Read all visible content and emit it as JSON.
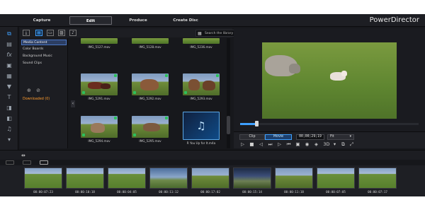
{
  "app": {
    "brand": "PowerDirector",
    "modes": [
      "Capture",
      "Edit",
      "Produce",
      "Create Disc"
    ],
    "active_mode": "Edit"
  },
  "tools": [
    {
      "icon": "media-room-icon"
    },
    {
      "icon": "title-room-icon"
    },
    {
      "icon": "fx-room-icon",
      "glyph": "fx"
    },
    {
      "icon": "pip-room-icon"
    },
    {
      "icon": "particle-room-icon"
    },
    {
      "icon": "text-room-icon",
      "glyph": "T"
    },
    {
      "icon": "transition-room-icon"
    },
    {
      "icon": "subtitle-room-icon"
    },
    {
      "icon": "audio-room-icon"
    },
    {
      "icon": "more-rooms-icon"
    }
  ],
  "library": {
    "search_placeholder": "Search the library",
    "categories": [
      "Media Content",
      "Color Boards",
      "Background Music",
      "Sound Clips"
    ],
    "active_category": "Media Content",
    "downloaded_label": "Downloaded",
    "downloaded_count": "(0)",
    "items": [
      {
        "label": "IMG_5127.mov",
        "type": "video",
        "partial": true
      },
      {
        "label": "IMG_5128.mov",
        "type": "video",
        "partial": true
      },
      {
        "label": "IMG_5236.mov",
        "type": "video",
        "partial": true
      },
      {
        "label": "IMG_5291.mov",
        "type": "video"
      },
      {
        "label": "IMG_5292.mov",
        "type": "video"
      },
      {
        "label": "IMG_5293.mov",
        "type": "video"
      },
      {
        "label": "IMG_5294.mov",
        "type": "video"
      },
      {
        "label": "IMG_5295.mov",
        "type": "video"
      },
      {
        "label": "R You Up for It.m4a",
        "type": "audio"
      }
    ]
  },
  "preview": {
    "clip_label": "Clip",
    "movie_label": "Movie",
    "active": "Movie",
    "timecode": "00;00;29;19",
    "fit_label": "Fit",
    "mode_3d": "3D",
    "progress": 0.09
  },
  "timeline": {
    "clips": [
      {
        "time": "00:00:07:23"
      },
      {
        "time": "00:00:10:18"
      },
      {
        "time": "00:00:04:05"
      },
      {
        "time": "00:00:11:12"
      },
      {
        "time": "00:00:17:02"
      },
      {
        "time": "00:00:15:14"
      },
      {
        "time": "00:00:11:18"
      },
      {
        "time": "00:00:07:05"
      },
      {
        "time": "00:00:07:17"
      }
    ]
  }
}
